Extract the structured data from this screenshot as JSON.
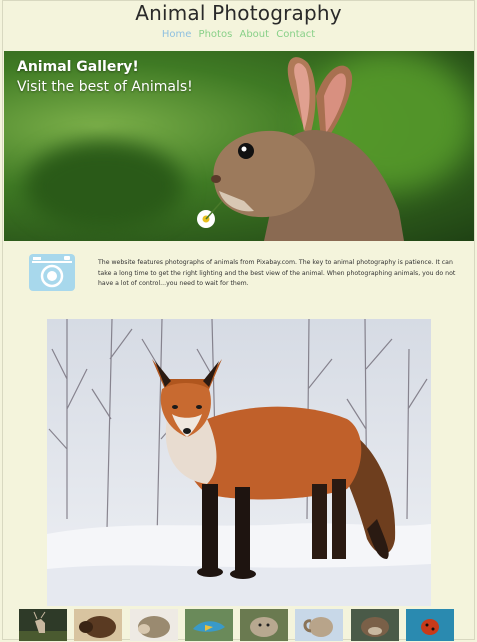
{
  "header": {
    "title": "Animal Photography",
    "nav": [
      {
        "label": "Home",
        "active": true
      },
      {
        "label": "Photos",
        "active": false
      },
      {
        "label": "About",
        "active": false
      },
      {
        "label": "Contact",
        "active": false
      }
    ]
  },
  "hero": {
    "heading": "Animal Gallery!",
    "subheading": "Visit the best of Animals!"
  },
  "intro": {
    "icon": "camera-icon",
    "text": "The website features photographs of animals from Pixabay.com. The key to animal photography is patience. It can take a long time to get the right lighting and the best view of the animal. When photographing animals, you do not have a lot of control...you need to wait for them."
  },
  "feature_image": {
    "subject": "red fox in snow"
  },
  "thumbnails": [
    {
      "subject": "deer"
    },
    {
      "subject": "bison"
    },
    {
      "subject": "hedgehog"
    },
    {
      "subject": "bird"
    },
    {
      "subject": "seal"
    },
    {
      "subject": "ram"
    },
    {
      "subject": "otter"
    },
    {
      "subject": "ladybug"
    }
  ],
  "colors": {
    "background": "#f4f4dc",
    "nav_active": "#8fc0e0",
    "nav_link": "#88d088",
    "title": "#2a2a2a"
  }
}
